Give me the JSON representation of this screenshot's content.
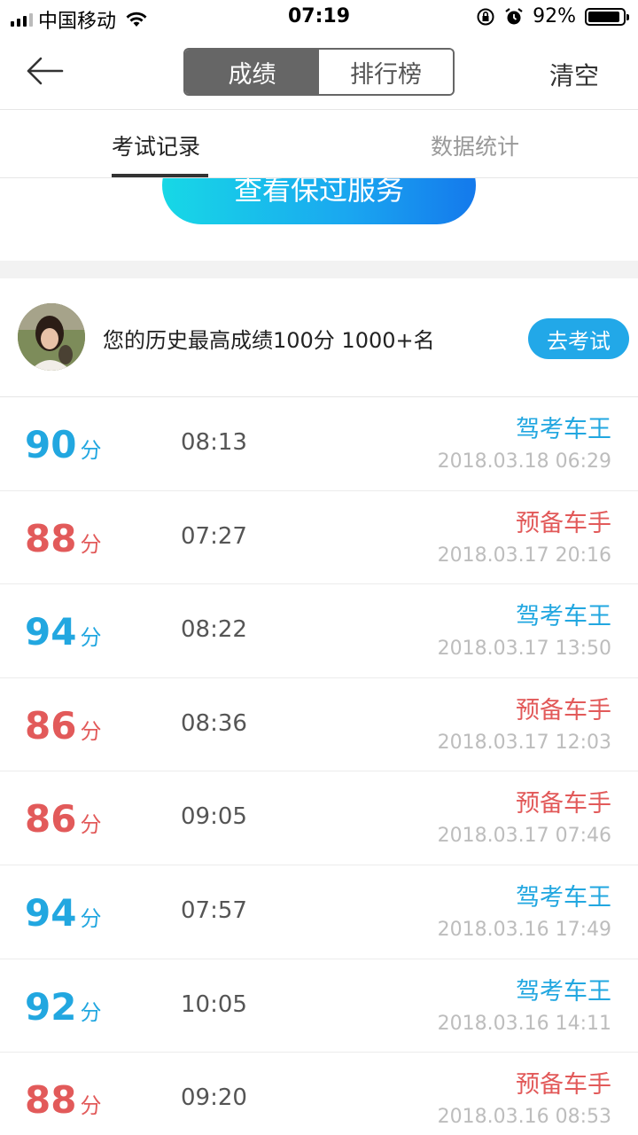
{
  "status_bar": {
    "carrier": "中国移动",
    "time": "07:19",
    "battery_pct": "92%",
    "battery_level": 0.92
  },
  "nav": {
    "tabs": [
      "成绩",
      "排行榜"
    ],
    "active_tab": 0,
    "clear_label": "清空"
  },
  "sub_tabs": [
    "考试记录",
    "数据统计"
  ],
  "banner": {
    "button_label": "查看保过服务"
  },
  "summary": {
    "text": "您的历史最高成绩100分  1000+名",
    "button_label": "去考试"
  },
  "score_unit": "分",
  "colors": {
    "pass": "#22a7e0",
    "fail": "#e25a5a",
    "accent": "#22a8e8"
  },
  "records": [
    {
      "score": "90",
      "duration": "08:13",
      "title": "驾考车王",
      "date": "2018.03.18 06:29",
      "status": "pass"
    },
    {
      "score": "88",
      "duration": "07:27",
      "title": "预备车手",
      "date": "2018.03.17 20:16",
      "status": "fail"
    },
    {
      "score": "94",
      "duration": "08:22",
      "title": "驾考车王",
      "date": "2018.03.17 13:50",
      "status": "pass"
    },
    {
      "score": "86",
      "duration": "08:36",
      "title": "预备车手",
      "date": "2018.03.17 12:03",
      "status": "fail"
    },
    {
      "score": "86",
      "duration": "09:05",
      "title": "预备车手",
      "date": "2018.03.17 07:46",
      "status": "fail"
    },
    {
      "score": "94",
      "duration": "07:57",
      "title": "驾考车王",
      "date": "2018.03.16 17:49",
      "status": "pass"
    },
    {
      "score": "92",
      "duration": "10:05",
      "title": "驾考车王",
      "date": "2018.03.16 14:11",
      "status": "pass"
    },
    {
      "score": "88",
      "duration": "09:20",
      "title": "预备车手",
      "date": "2018.03.16 08:53",
      "status": "fail"
    }
  ]
}
